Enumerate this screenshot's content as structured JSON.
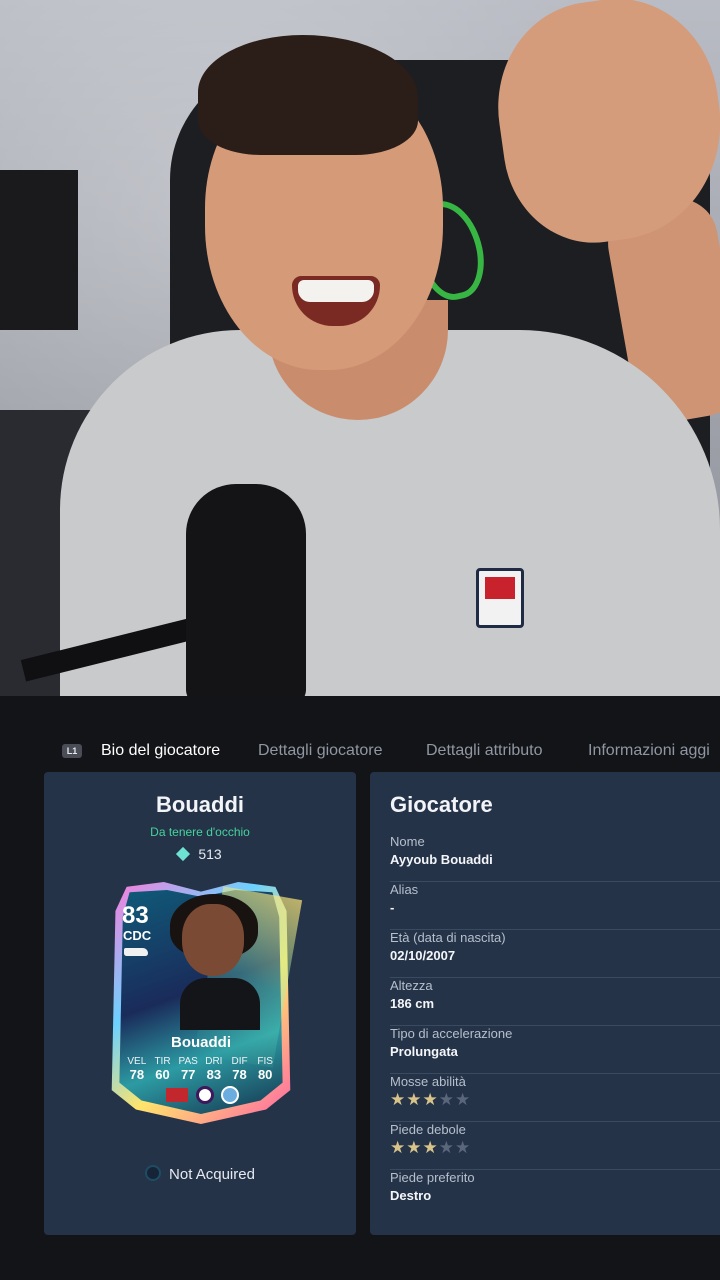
{
  "tabs": {
    "hint": "L1",
    "items": [
      {
        "label": "Bio del giocatore",
        "active": true
      },
      {
        "label": "Dettagli giocatore",
        "active": false
      },
      {
        "label": "Dettagli attributo",
        "active": false
      },
      {
        "label": "Informazioni aggi",
        "active": false
      }
    ]
  },
  "card_panel": {
    "name": "Bouaddi",
    "tag": "Da tenere d'occhio",
    "price": "513",
    "card": {
      "rating": "83",
      "position": "CDC",
      "name": "Bouaddi",
      "stats": [
        {
          "label": "VEL",
          "value": "78"
        },
        {
          "label": "TIR",
          "value": "60"
        },
        {
          "label": "PAS",
          "value": "77"
        },
        {
          "label": "DRI",
          "value": "83"
        },
        {
          "label": "DIF",
          "value": "78"
        },
        {
          "label": "FIS",
          "value": "80"
        }
      ]
    },
    "acquired_status": "Not Acquired"
  },
  "info_panel": {
    "title": "Giocatore",
    "rows": [
      {
        "label": "Nome",
        "value": "Ayyoub Bouaddi"
      },
      {
        "label": "Alias",
        "value": "-"
      },
      {
        "label": "Età (data di nascita)",
        "value": "02/10/2007"
      },
      {
        "label": "Altezza",
        "value": "186 cm"
      },
      {
        "label": "Tipo di accelerazione",
        "value": "Prolungata"
      },
      {
        "label": "Mosse abilità",
        "stars": 3,
        "max": 5
      },
      {
        "label": "Piede debole",
        "stars": 3,
        "max": 5
      },
      {
        "label": "Piede preferito",
        "value": "Destro"
      }
    ]
  },
  "colors": {
    "panel_bg": "#253349",
    "tag_green": "#46d39b",
    "star_on": "#d8c48a",
    "star_off": "#5a667a"
  }
}
